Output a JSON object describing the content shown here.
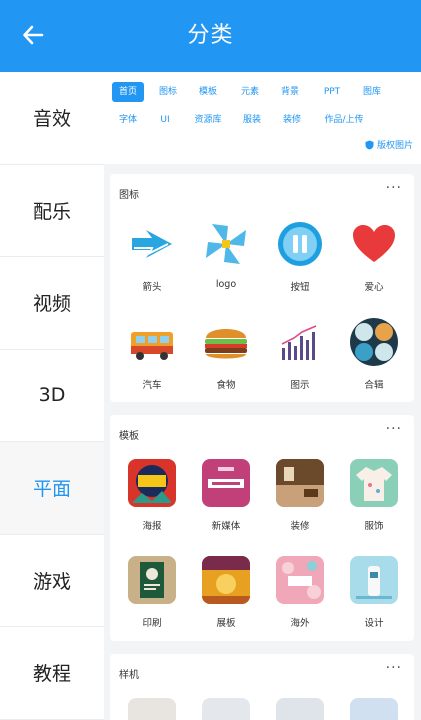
{
  "header": {
    "title": "分类"
  },
  "sidebar": {
    "items": [
      {
        "label": "音效"
      },
      {
        "label": "配乐"
      },
      {
        "label": "视频"
      },
      {
        "label": "3D"
      },
      {
        "label": "平面",
        "active": true
      },
      {
        "label": "游戏"
      },
      {
        "label": "教程"
      }
    ]
  },
  "tags": {
    "row1": [
      "首页",
      "图标",
      "模板",
      "元素",
      "背景",
      "PPT",
      "图库"
    ],
    "row2": [
      "字体",
      "UI",
      "资源库",
      "服装",
      "装修",
      "作品/上传"
    ],
    "active": "首页",
    "copyright": "版权图片"
  },
  "sections": {
    "icons": {
      "title": "图标",
      "more": "···",
      "items": [
        {
          "label": "箭头",
          "icon": "arrow-icon"
        },
        {
          "label": "logo",
          "icon": "logo-icon"
        },
        {
          "label": "按钮",
          "icon": "pause-button-icon"
        },
        {
          "label": "爱心",
          "icon": "heart-icon"
        },
        {
          "label": "汽车",
          "icon": "bus-icon"
        },
        {
          "label": "食物",
          "icon": "burger-icon"
        },
        {
          "label": "图示",
          "icon": "chart-icon"
        },
        {
          "label": "合辑",
          "icon": "collection-icon"
        }
      ]
    },
    "templates": {
      "title": "模板",
      "more": "···",
      "items": [
        {
          "label": "海报",
          "icon": "poster-thumb"
        },
        {
          "label": "新媒体",
          "icon": "new-media-thumb"
        },
        {
          "label": "装修",
          "icon": "decoration-thumb"
        },
        {
          "label": "服饰",
          "icon": "clothing-thumb"
        },
        {
          "label": "印刷",
          "icon": "print-thumb"
        },
        {
          "label": "展板",
          "icon": "display-board-thumb"
        },
        {
          "label": "海外",
          "icon": "overseas-thumb"
        },
        {
          "label": "设计",
          "icon": "design-thumb"
        }
      ]
    },
    "mockups": {
      "title": "样机",
      "more": "···"
    }
  }
}
